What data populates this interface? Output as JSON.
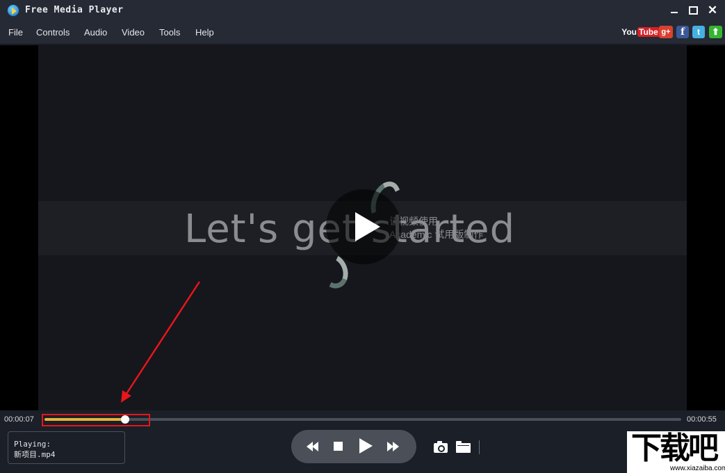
{
  "window": {
    "title": "Free Media Player"
  },
  "menu": {
    "items": [
      "File",
      "Controls",
      "Audio",
      "Video",
      "Tools",
      "Help"
    ]
  },
  "social": {
    "youtube_you": "You",
    "youtube_tube": "Tube",
    "googleplus": "g+",
    "facebook": "f",
    "twitter": "t",
    "upload": "⬆"
  },
  "video": {
    "caption": "Let's get started",
    "watermark_cn": "该视频使用",
    "watermark_en": "Academic 试用版制作"
  },
  "playback": {
    "current_time": "00:00:07",
    "total_time": "00:00:55",
    "progress_fraction": 0.127
  },
  "status": {
    "label": "Playing:",
    "filename": "新项目.mp4"
  },
  "site_logo": {
    "text": "下载吧",
    "url": "www.xiazaiba.com"
  },
  "colors": {
    "progress": "#e8b23a",
    "annotation": "#e8151b",
    "background": "#1b1f27"
  }
}
